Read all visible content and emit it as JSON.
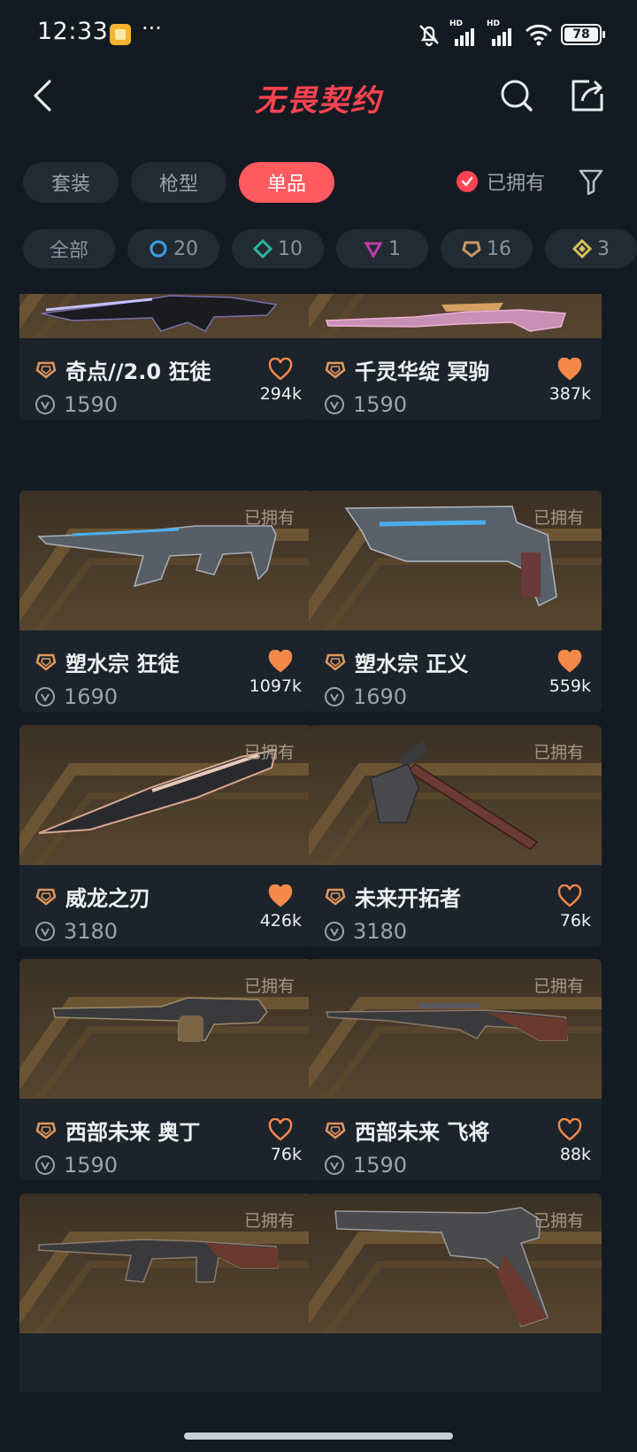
{
  "status_bar": {
    "time": "12:33",
    "dots": "···",
    "signal_label": "HD",
    "battery": "78"
  },
  "header": {
    "title": "无畏契约",
    "back_icon": "chevron-left-icon",
    "search_icon": "search-icon",
    "share_icon": "share-icon"
  },
  "tabs": [
    {
      "label": "套装",
      "active": false
    },
    {
      "label": "枪型",
      "active": false
    },
    {
      "label": "单品",
      "active": true
    }
  ],
  "owned_filter": {
    "label": "已拥有",
    "checked": true
  },
  "tiers": [
    {
      "label": "全部",
      "icon": "none"
    },
    {
      "label": "20",
      "icon": "select-tier-icon",
      "color": "#3aa0e8"
    },
    {
      "label": "10",
      "icon": "deluxe-tier-icon",
      "color": "#2bb3a0"
    },
    {
      "label": "1",
      "icon": "premium-tier-icon",
      "color": "#c03ea8"
    },
    {
      "label": "16",
      "icon": "exclusive-tier-icon",
      "color": "#c89a64"
    },
    {
      "label": "3",
      "icon": "ultra-tier-icon",
      "color": "#d8c05a"
    }
  ],
  "owned_tag": "已拥有",
  "items": [
    {
      "name": "奇点//2.0 狂徒",
      "price": "1590",
      "likes": "294k",
      "liked": false,
      "owned_tag_visible": true
    },
    {
      "name": "千灵华绽 冥驹",
      "price": "1590",
      "likes": "387k",
      "liked": true,
      "owned_tag_visible": true
    },
    {
      "name": "塑水宗 狂徒",
      "price": "1690",
      "likes": "1097k",
      "liked": true,
      "owned_tag_visible": true
    },
    {
      "name": "塑水宗 正义",
      "price": "1690",
      "likes": "559k",
      "liked": true,
      "owned_tag_visible": true
    },
    {
      "name": "威龙之刃",
      "price": "3180",
      "likes": "426k",
      "liked": true,
      "owned_tag_visible": true
    },
    {
      "name": "未来开拓者",
      "price": "3180",
      "likes": "76k",
      "liked": false,
      "owned_tag_visible": true
    },
    {
      "name": "西部未来 奥丁",
      "price": "1590",
      "likes": "76k",
      "liked": false,
      "owned_tag_visible": true
    },
    {
      "name": "西部未来 飞将",
      "price": "1590",
      "likes": "88k",
      "liked": false,
      "owned_tag_visible": true
    },
    {
      "name": "",
      "price": "",
      "likes": "",
      "liked": false,
      "owned_tag_visible": true
    },
    {
      "name": "",
      "price": "",
      "likes": "",
      "liked": false,
      "owned_tag_visible": true
    }
  ],
  "colors": {
    "accent": "#ff4452",
    "tab_active": "#ff5a5f",
    "heart": "#f5894a",
    "tier_exclusive": "#e0955a"
  }
}
